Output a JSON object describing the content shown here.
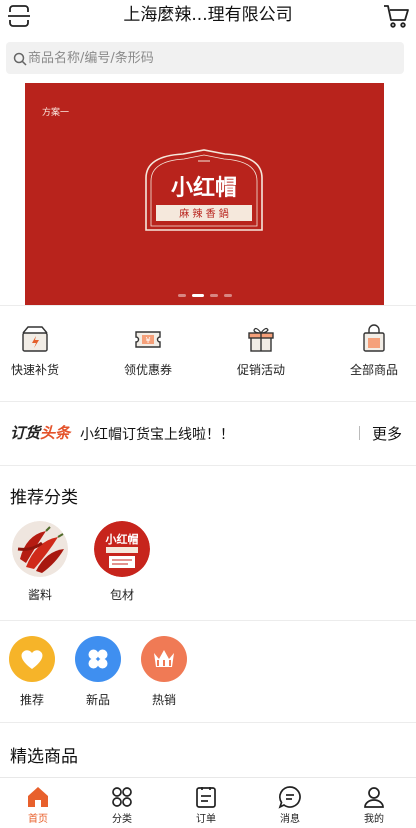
{
  "header": {
    "title": "上海麼辣...理有限公司",
    "menu_icon": "scan-frame-icon",
    "cart_icon": "shopping-cart-icon"
  },
  "search": {
    "placeholder": "商品名称/编号/条形码",
    "icon": "search-icon"
  },
  "banner": {
    "tag": "方案一",
    "logo_text": "小红帽",
    "logo_subtext": "麻辣香锅",
    "slide_count": 4,
    "active_slide": 2,
    "background_color": "#b8231c"
  },
  "quick_menu": [
    {
      "label": "快速补货",
      "icon": "restock-box-icon"
    },
    {
      "label": "领优惠券",
      "icon": "coupon-icon"
    },
    {
      "label": "促销活动",
      "icon": "gift-box-icon"
    },
    {
      "label": "全部商品",
      "icon": "shopping-bag-icon"
    }
  ],
  "headline": {
    "brand_prefix": "订货",
    "brand_highlight": "头条",
    "text": "小红帽订货宝上线啦！！",
    "more_label": "更多"
  },
  "recommended": {
    "title": "推荐分类",
    "items": [
      {
        "label": "酱料"
      },
      {
        "label": "包材"
      }
    ]
  },
  "tags": [
    {
      "label": "推荐",
      "icon": "heart-icon",
      "color": "#f6b429"
    },
    {
      "label": "新品",
      "icon": "clover-icon",
      "color": "#3f8ff0"
    },
    {
      "label": "热销",
      "icon": "crown-icon",
      "color": "#f07a55"
    }
  ],
  "featured": {
    "title": "精选商品"
  },
  "tabbar": {
    "accent": "#e8602c",
    "items": [
      {
        "label": "首页",
        "icon": "home-icon",
        "active": true
      },
      {
        "label": "分类",
        "icon": "category-grid-icon",
        "active": false
      },
      {
        "label": "订单",
        "icon": "order-list-icon",
        "active": false
      },
      {
        "label": "消息",
        "icon": "message-bubble-icon",
        "active": false
      },
      {
        "label": "我的",
        "icon": "user-icon",
        "active": false
      }
    ]
  }
}
